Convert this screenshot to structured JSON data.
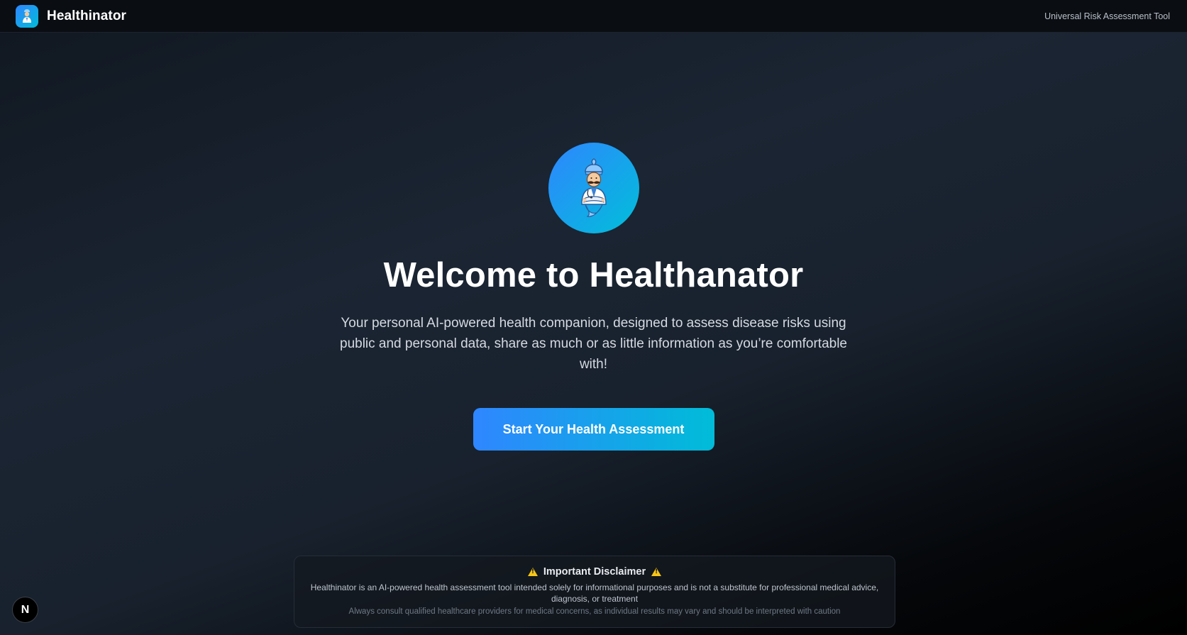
{
  "header": {
    "brand_name": "Healthinator",
    "tool_label": "Universal Risk Assessment Tool"
  },
  "hero": {
    "icon": "doctor-genie-mascot",
    "title": "Welcome to Healthanator",
    "subtitle": "Your personal AI-powered health companion, designed to assess disease risks using public and personal data, share as much or as little information as you’re comfortable with!",
    "cta_label": "Start Your Health Assessment"
  },
  "disclaimer": {
    "title": "Important Disclaimer",
    "icon": "warning-icon",
    "body": "Healthinator is an AI-powered health assessment tool intended solely for informational purposes and is not a substitute for professional medical advice, diagnosis, or treatment",
    "note": "Always consult qualified healthcare providers for medical concerns, as individual results may vary and should be interpreted with caution"
  },
  "badge": {
    "label": "N"
  },
  "colors": {
    "accent_start": "#2f86ff",
    "accent_end": "#00bcd8",
    "warning": "#f5c518"
  }
}
